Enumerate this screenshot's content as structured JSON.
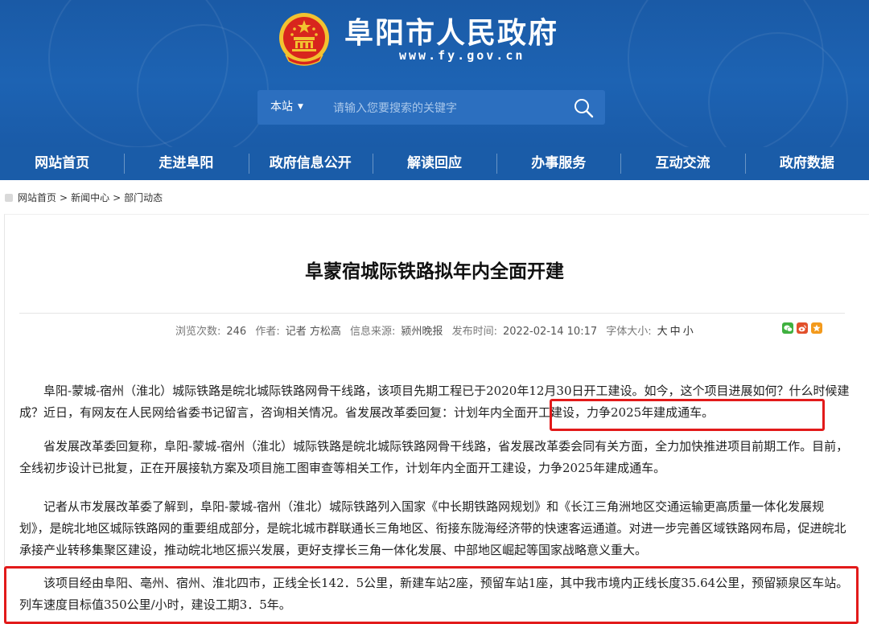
{
  "header": {
    "title": "阜阳市人民政府",
    "url": "www.fy.gov.cn",
    "emblem_icon": "national-emblem-icon"
  },
  "search": {
    "scope": "本站",
    "placeholder": "请输入您要搜索的关键字"
  },
  "nav": {
    "items": [
      "网站首页",
      "走进阜阳",
      "政府信息公开",
      "解读回应",
      "办事服务",
      "互动交流",
      "政府数据"
    ]
  },
  "breadcrumb": {
    "home": "网站首页",
    "sep": ">",
    "news": "新闻中心",
    "dept": "部门动态"
  },
  "article": {
    "title": "阜蒙宿城际铁路拟年内全面开建",
    "meta": {
      "views_label": "浏览次数:",
      "views": "246",
      "author_label": "作者:",
      "author": "记者 方松高",
      "source_label": "信息来源:",
      "source": "颍州晚报",
      "date_label": "发布时间:",
      "date": "2022-02-14 10:17",
      "fontsize_label": "字体大小:",
      "font_large": "大",
      "font_medium": "中",
      "font_small": "小"
    },
    "paragraphs": [
      "阜阳-蒙城-宿州（淮北）城际铁路是皖北城际铁路网骨干线路，该项目先期工程已于2020年12月30日开工建设。如今，这个项目进展如何？什么时候建成？近日，有网友在人民网给省委书记留言，咨询相关情况。省发展改革委回复：计划年内全面开工建设，力争2025年建成通车。",
      "省发展改革委回复称，阜阳-蒙城-宿州（淮北）城际铁路是皖北城际铁路网骨干线路，省发展改革委会同有关方面，全力加快推进项目前期工作。目前，全线初步设计已批复，正在开展接轨方案及项目施工图审查等相关工作，计划年内全面开工建设，力争2025年建成通车。",
      "记者从市发展改革委了解到，阜阳-蒙城-宿州（淮北）城际铁路列入国家《中长期铁路网规划》和《长江三角洲地区交通运输更高质量一体化发展规划》，是皖北地区城际铁路网的重要组成部分，是皖北城市群联通长三角地区、衔接东陇海经济带的快速客运通道。对进一步完善区域铁路网布局，促进皖北承接产业转移集聚区建设，推动皖北地区振兴发展，更好支撑长三角一体化发展、中部地区崛起等国家战略意义重大。",
      "该项目经由阜阳、亳州、宿州、淮北四市，正线全长142．5公里，新建车站2座，预留车站1座，其中我市境内正线长度35.64公里，预留颍泉区车站。列车速度目标值350公里/小时，建设工期3．5年。"
    ]
  },
  "share": {
    "icons": [
      "wechat-icon",
      "weibo-icon",
      "favorite-icon"
    ]
  },
  "colors": {
    "header_blue": "#1d63b3",
    "nav_blue": "#1a5ca8",
    "highlight_red": "#e21a1a",
    "wechat_green": "#3fb03f",
    "weibo_red": "#e2502b",
    "favorite_orange": "#f39a1c"
  }
}
